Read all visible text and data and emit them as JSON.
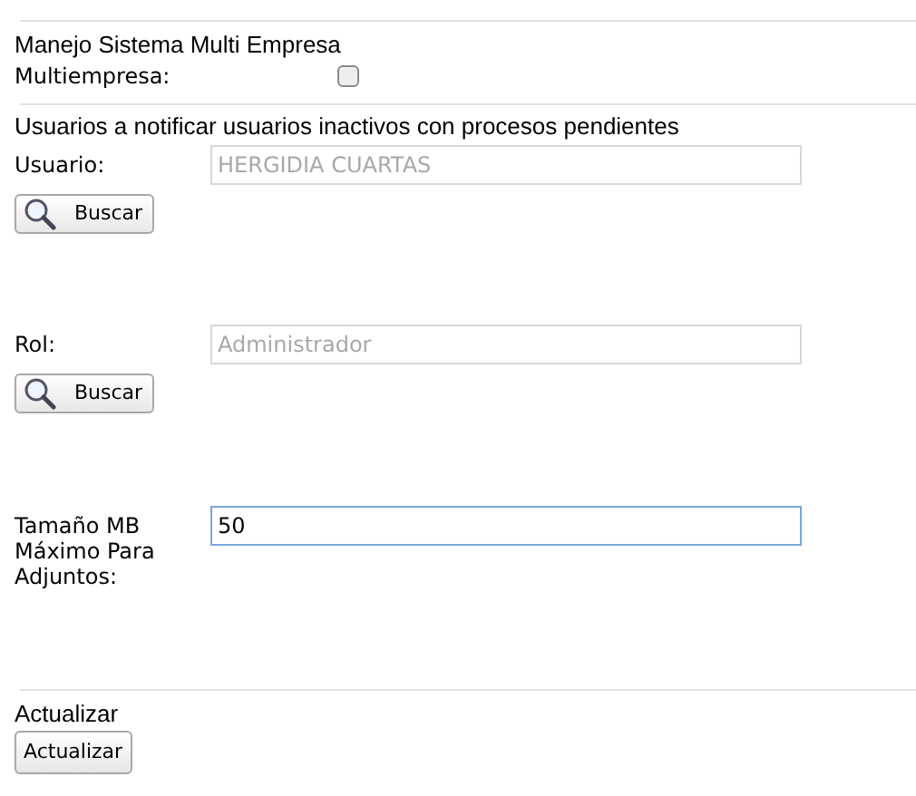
{
  "multi_company": {
    "title": "Manejo Sistema Multi Empresa",
    "field": {
      "label": "Multiempresa:",
      "checked": false
    }
  },
  "notify_section": {
    "title": "Usuarios a notificar usuarios inactivos con procesos pendientes",
    "user": {
      "label": "Usuario:",
      "value": "HERGIDIA CUARTAS",
      "disabled": true,
      "button": "Buscar"
    },
    "role": {
      "label": "Rol:",
      "value": "Administrador",
      "disabled": true,
      "button": "Buscar"
    },
    "max_size": {
      "label": "Tamaño MB Máximo Para Adjuntos:",
      "value": "50",
      "disabled": false,
      "focused": true
    }
  },
  "update_section": {
    "title": "Actualizar",
    "button": "Actualizar"
  }
}
